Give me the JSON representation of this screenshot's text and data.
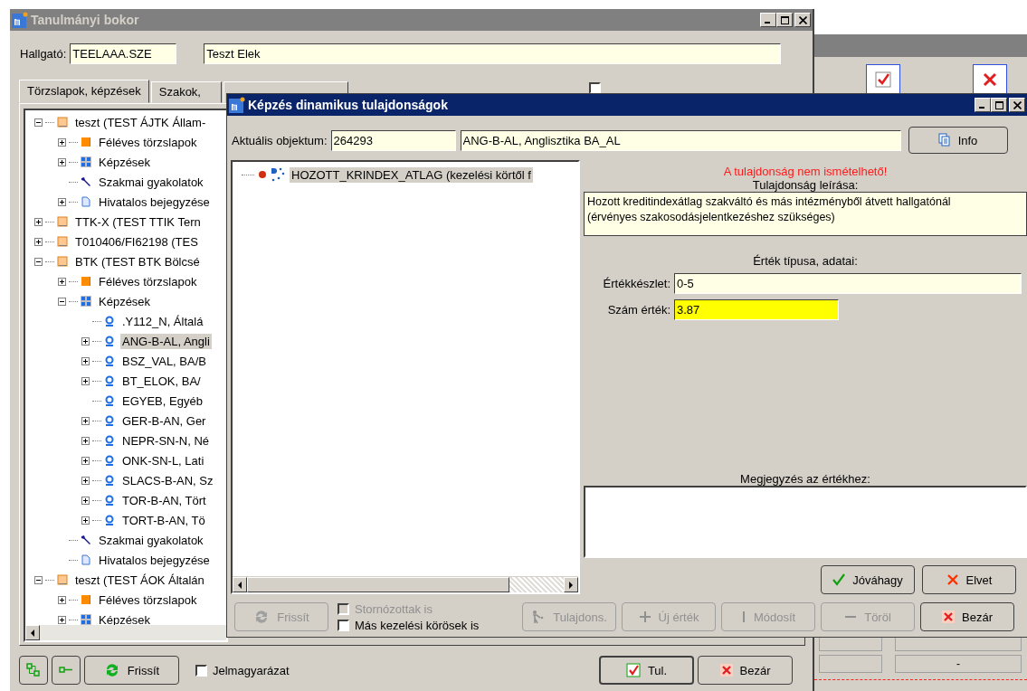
{
  "main_window": {
    "title": "Tanulmányi bokor",
    "student_label": "Hallgató:",
    "student_code": "TEELAAA.SZE",
    "student_name": "Teszt Elek",
    "tabs": [
      {
        "label": "Törzslapok, képzések",
        "selected": true
      },
      {
        "label": "Szakok,",
        "selected": false
      },
      {
        "selected": false
      }
    ],
    "side_checkbox": {
      "checked": false
    },
    "tree": [
      {
        "label": "teszt (TEST ÁJTK Állam-",
        "kind": "faculty",
        "expanded": true,
        "selected": false,
        "children": [
          {
            "label": "Féléves törzslapok",
            "kind": "semester",
            "expanded": false,
            "selected": false
          },
          {
            "label": "Képzések",
            "kind": "trainings",
            "expanded": false,
            "selected": false
          },
          {
            "label": "Szakmai gyakolatok",
            "kind": "practice",
            "selected": false
          },
          {
            "label": "Hivatalos bejegyzése",
            "kind": "document",
            "expanded": false,
            "selected": false
          }
        ]
      },
      {
        "label": "TTK-X (TEST TTIK Tern",
        "kind": "faculty",
        "expanded": false,
        "selected": false
      },
      {
        "label": "T010406/FI62198 (TES",
        "kind": "faculty",
        "expanded": false,
        "selected": false
      },
      {
        "label": "BTK (TEST BTK Bölcsé",
        "kind": "faculty",
        "expanded": true,
        "selected": false,
        "children": [
          {
            "label": "Féléves törzslapok",
            "kind": "semester",
            "expanded": false,
            "selected": false
          },
          {
            "label": "Képzések",
            "kind": "trainings",
            "expanded": true,
            "selected": false,
            "children": [
              {
                "label": ".Y112_N, Általá",
                "kind": "training",
                "selected": false
              },
              {
                "label": "ANG-B-AL, Angli",
                "kind": "training",
                "expanded": false,
                "selected": true
              },
              {
                "label": "BSZ_VAL, BA/B",
                "kind": "training",
                "expanded": false,
                "selected": false
              },
              {
                "label": "BT_ELOK, BA/",
                "kind": "training",
                "expanded": false,
                "selected": false
              },
              {
                "label": "EGYEB, Egyéb",
                "kind": "training",
                "selected": false
              },
              {
                "label": "GER-B-AN, Ger",
                "kind": "training",
                "expanded": false,
                "selected": false
              },
              {
                "label": "NEPR-SN-N, Né",
                "kind": "training",
                "expanded": false,
                "selected": false
              },
              {
                "label": "ONK-SN-L, Lati",
                "kind": "training",
                "expanded": false,
                "selected": false
              },
              {
                "label": "SLACS-B-AN, Sz",
                "kind": "training",
                "expanded": false,
                "selected": false
              },
              {
                "label": "TOR-B-AN, Tört",
                "kind": "training",
                "expanded": false,
                "selected": false
              },
              {
                "label": "TORT-B-AN, Tö",
                "kind": "training",
                "expanded": false,
                "selected": false
              }
            ]
          },
          {
            "label": "Szakmai gyakolatok",
            "kind": "practice",
            "selected": false
          },
          {
            "label": "Hivatalos bejegyzése",
            "kind": "document",
            "selected": false
          }
        ]
      },
      {
        "label": "teszt (TEST ÁOK Általán",
        "kind": "faculty",
        "expanded": true,
        "selected": false,
        "children": [
          {
            "label": "Féléves törzslapok",
            "kind": "semester",
            "expanded": false,
            "selected": false
          },
          {
            "label": "Képzések",
            "kind": "trainings",
            "expanded": false,
            "selected": false
          }
        ]
      }
    ],
    "bottom": {
      "refresh": "Frissít",
      "legend": {
        "label": "Jelmagyarázat",
        "checked": false
      },
      "ok": "Tul.",
      "close": "Bezár"
    }
  },
  "dialog": {
    "title": "Képzés dinamikus tulajdonságok",
    "object_label": "Aktuális objektum:",
    "object_id": "264293",
    "object_name": "ANG-B-AL, Anglisztika BA_AL",
    "info": "Info",
    "tree": [
      {
        "label": "HOZOTT_KRINDEX_ATLAG (kezelési körtől f",
        "selected": true
      }
    ],
    "warning": "A tulajdonság nem ismételhető!",
    "description_label": "Tulajdonság leírása:",
    "description_lines": [
      "Hozott kreditindexátlag szakváltó és más intézményből átvett hallgatónál",
      "(érvényes szakosodásjelentkezéshez szükséges)"
    ],
    "value_type_label": "Érték típusa,  adatai:",
    "value_set_label": "Értékkészlet:",
    "value_set": "0-5",
    "number_label": "Szám érték:",
    "number_value": "3.87",
    "note_label": "Megjegyzés az értékhez:",
    "accept": "Jóváhagy",
    "reject": "Elvet",
    "refresh": {
      "label": "Frissít",
      "disabled": true
    },
    "checkboxes": [
      {
        "label": "Stornózottak is",
        "checked": false,
        "disabled": true
      },
      {
        "label": "Más kezelési körösek is",
        "checked": false,
        "disabled": false
      }
    ],
    "actions": [
      {
        "label": "Tulajdons.",
        "kind": "property",
        "disabled": true
      },
      {
        "label": "Új érték",
        "kind": "add",
        "disabled": true
      },
      {
        "label": "Módosít",
        "kind": "edit",
        "disabled": true
      },
      {
        "label": "Töröl",
        "kind": "delete",
        "disabled": true
      },
      {
        "label": "Bezár",
        "kind": "close",
        "disabled": false
      }
    ]
  },
  "back_window": {
    "cell_value": "-"
  }
}
